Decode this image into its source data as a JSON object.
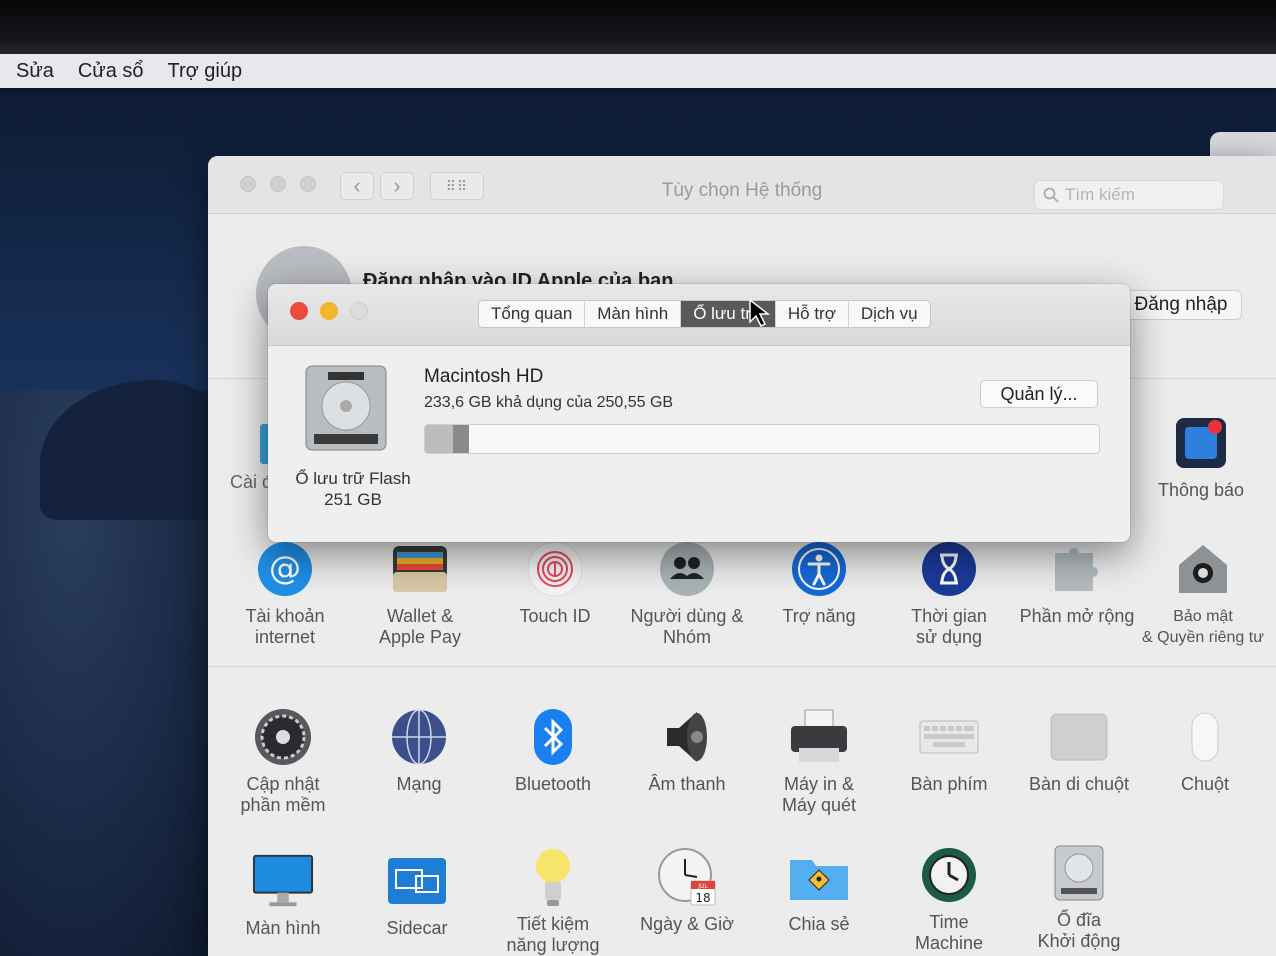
{
  "menubar": {
    "items": [
      "Sửa",
      "Cửa sổ",
      "Trợ giúp"
    ]
  },
  "prefs": {
    "title": "Tùy chọn Hệ thống",
    "search_placeholder": "Tìm kiếm",
    "apple_id_heading": "Đăng nhập vào ID Apple của bạn",
    "signin_label": "Đăng nhập",
    "partial_left_label": "Cài đ",
    "notifications_label": "Thông báo",
    "row2": [
      {
        "label": "Tài khoản\ninternet",
        "icon": "at-icon"
      },
      {
        "label": "Wallet &\nApple Pay",
        "icon": "wallet-icon"
      },
      {
        "label": "Touch ID",
        "icon": "fingerprint-icon"
      },
      {
        "label": "Người dùng &\nNhóm",
        "icon": "users-icon"
      },
      {
        "label": "Trợ năng",
        "icon": "accessibility-icon"
      },
      {
        "label": "Thời gian\nsử dụng",
        "icon": "hourglass-icon"
      },
      {
        "label": "Phần mở rộng",
        "icon": "puzzle-icon"
      },
      {
        "label": "Bảo mật\n& Quyền riêng tư",
        "icon": "house-lock-icon"
      }
    ],
    "row3": [
      {
        "label": "Cập nhật\nphần mềm",
        "icon": "gear-icon"
      },
      {
        "label": "Mạng",
        "icon": "globe-icon"
      },
      {
        "label": "Bluetooth",
        "icon": "bluetooth-icon"
      },
      {
        "label": "Âm thanh",
        "icon": "speaker-icon"
      },
      {
        "label": "Máy in &\nMáy quét",
        "icon": "printer-icon"
      },
      {
        "label": "Bàn phím",
        "icon": "keyboard-icon"
      },
      {
        "label": "Bàn di chuột",
        "icon": "trackpad-icon"
      },
      {
        "label": "Chuột",
        "icon": "mouse-icon"
      }
    ],
    "row4": [
      {
        "label": "Màn hình",
        "icon": "display-icon"
      },
      {
        "label": "Sidecar",
        "icon": "sidecar-icon"
      },
      {
        "label": "Tiết kiệm\nnăng lượng",
        "icon": "lightbulb-icon"
      },
      {
        "label": "Ngày & Giờ",
        "icon": "clock-calendar-icon"
      },
      {
        "label": "Chia sẻ",
        "icon": "shared-folder-icon"
      },
      {
        "label": "Time\nMachine",
        "icon": "time-machine-icon"
      },
      {
        "label": "Ổ đĩa\nKhởi động",
        "icon": "startup-disk-icon"
      }
    ],
    "calendar_month": "JUL",
    "calendar_day": "18"
  },
  "about": {
    "tabs": [
      "Tổng quan",
      "Màn hình",
      "Ổ lưu trữ",
      "Hỗ trợ",
      "Dịch vụ"
    ],
    "active_tab": 2,
    "active_tab_visible_text": "Ổ lưu tr",
    "disk_caption_line1": "Ổ lưu trữ Flash",
    "disk_caption_line2": "251 GB",
    "disk_name": "Macintosh HD",
    "disk_available": "233,6 GB khả dụng của 250,55 GB",
    "manage_label": "Quản lý...",
    "used_fraction": 0.068
  },
  "colors": {
    "close": "#ee4b3f",
    "minimize": "#f4b42b",
    "zoom_inactive": "#dcdcdc",
    "at_blue": "#1f8fe6",
    "bluetooth_blue": "#1a7ff0",
    "accessibility_blue": "#1668d8",
    "hourglass_navy": "#1b3a9a"
  }
}
